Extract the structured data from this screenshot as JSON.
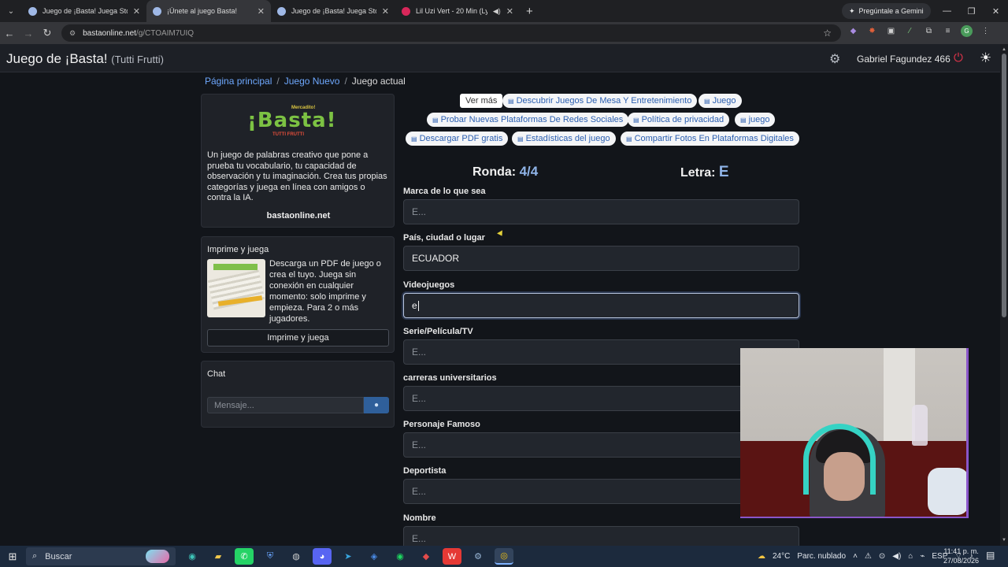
{
  "browser": {
    "tabs": [
      {
        "title": "Juego de ¡Basta! Juega Stop, Tu",
        "active": false
      },
      {
        "title": "¡Únete al juego Basta!",
        "active": true
      },
      {
        "title": "Juego de ¡Basta! Juega Stop, Tu",
        "active": false
      },
      {
        "title": "Lil Uzi Vert - 20 Min (Lyrics)",
        "active": false
      }
    ],
    "gemini_label": "Pregúntale a Gemini",
    "url_host": "bastaonline.net",
    "url_path": "/g/CTOAIM7UIQ"
  },
  "navbar": {
    "title": "Juego de ¡Basta!",
    "subtitle": "(Tutti Frutti)",
    "username": "Gabriel Fagundez 466"
  },
  "breadcrumb": {
    "home": "Página principal",
    "new_game": "Juego Nuevo",
    "current": "Juego actual"
  },
  "sidebar": {
    "logo": {
      "small": "Mercadito!",
      "big": "¡Basta!",
      "sub": "TUTTI FRUTTI"
    },
    "description": "Un juego de palabras creativo que pone a prueba tu vocabulario, tu capacidad de observación y tu imaginación. Crea tus propias categorías y juega en línea con amigos o contra la IA.",
    "site": "bastaonline.net",
    "print_card": {
      "header": "Imprime y juega",
      "text": "Descarga un PDF de juego o crea el tuyo. Juega sin conexión en cualquier momento: solo imprime y empieza. Para 2 o más jugadores.",
      "button": "Imprime y juega"
    },
    "chat": {
      "header": "Chat",
      "placeholder": "Mensaje..."
    }
  },
  "pills": {
    "ver_mas": "Ver más",
    "items": [
      "Descubrir Juegos De Mesa Y Entretenimiento",
      "Juego",
      "Probar Nuevas Plataformas De Redes Sociales",
      "Política de privacidad",
      "juego",
      "Descargar PDF gratis",
      "Estadísticas del juego",
      "Compartir Fotos En Plataformas Digitales"
    ]
  },
  "game": {
    "round_label": "Ronda:",
    "round_value": "4/4",
    "letter_label": "Letra:",
    "letter_value": "E"
  },
  "fields": [
    {
      "label": "Marca de lo que sea",
      "value": "",
      "placeholder": "E..."
    },
    {
      "label": "País, ciudad o lugar",
      "value": "ECUADOR",
      "placeholder": "E..."
    },
    {
      "label": "Videojuegos",
      "value": "e",
      "placeholder": "E..."
    },
    {
      "label": "Serie/Película/TV",
      "value": "",
      "placeholder": "E..."
    },
    {
      "label": "carreras universitarios",
      "value": "",
      "placeholder": "E..."
    },
    {
      "label": "Personaje Famoso",
      "value": "",
      "placeholder": "E..."
    },
    {
      "label": "Deportista",
      "value": "",
      "placeholder": "E..."
    },
    {
      "label": "Nombre",
      "value": "",
      "placeholder": "E..."
    }
  ],
  "taskbar": {
    "search": "Buscar",
    "weather": "24°C",
    "weather_desc": "Parc. nublado",
    "lang": "ESP",
    "time": "11:41 p. m.",
    "date": "27/08/2026"
  }
}
